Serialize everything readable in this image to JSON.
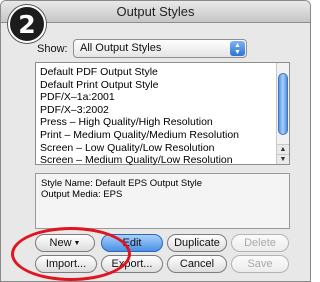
{
  "dialog": {
    "title": "Output Styles",
    "step_number": "2"
  },
  "show": {
    "label": "Show:",
    "selected": "All Output Styles"
  },
  "style_list": {
    "items": [
      "Default PDF Output Style",
      "Default Print Output Style",
      "PDF/X–1a:2001",
      "PDF/X–3:2002",
      "Press – High Quality/High Resolution",
      "Print – Medium Quality/Medium Resolution",
      "Screen – Low Quality/Low Resolution",
      "Screen – Medium Quality/Low Resolution"
    ]
  },
  "info": {
    "style_name": "Style Name: Default EPS Output Style",
    "output_media": "Output Media: EPS"
  },
  "buttons": {
    "new": "New",
    "edit": "Edit",
    "duplicate": "Duplicate",
    "delete": "Delete",
    "import": "Import...",
    "export": "Export...",
    "cancel": "Cancel",
    "save": "Save"
  },
  "colors": {
    "highlight": "#e2141f",
    "default_button": "#4b90e6"
  }
}
